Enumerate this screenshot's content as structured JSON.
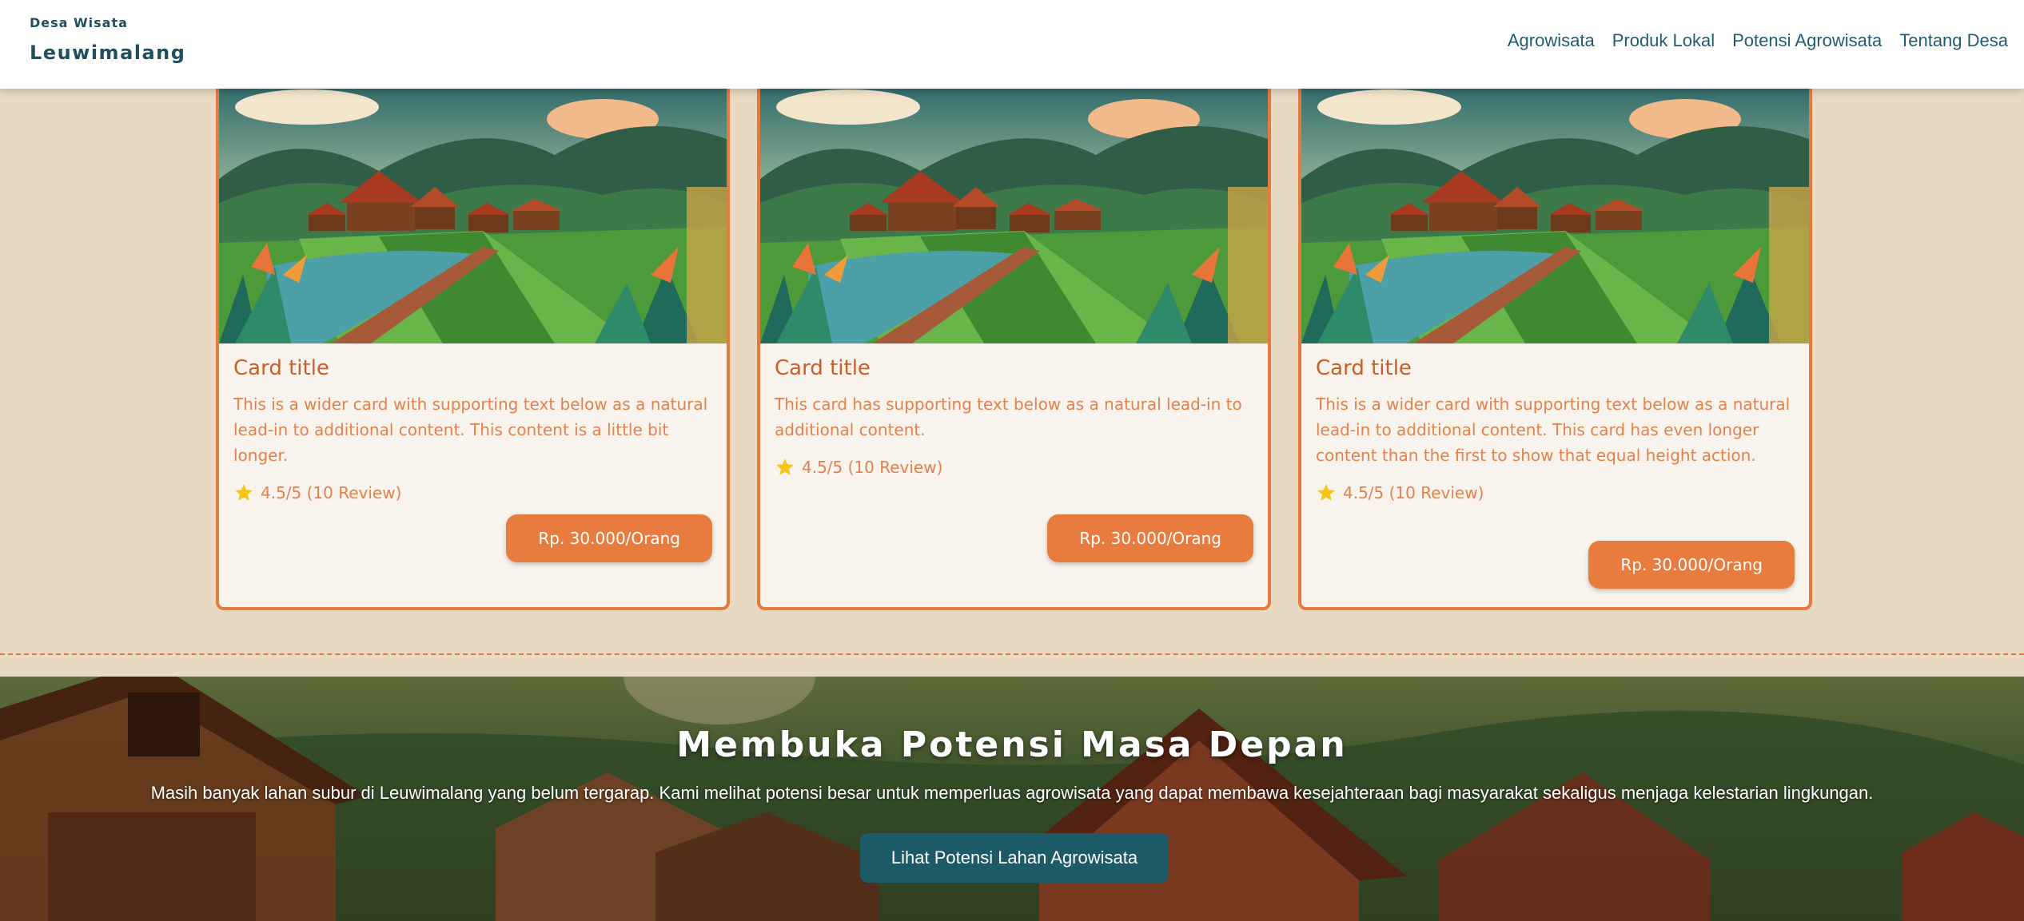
{
  "navbar": {
    "brand_top": "Desa Wisata",
    "brand_main": "Leuwimalang",
    "links": [
      "Agrowisata",
      "Produk Lokal",
      "Potensi Agrowisata",
      "Tentang Desa"
    ]
  },
  "cards": [
    {
      "title": "Card title",
      "text": "This is a wider card with supporting text below as a natural lead-in to additional content. This content is a little bit longer.",
      "rating": "4.5/5 (10 Review)",
      "price": "Rp. 30.000/Orang"
    },
    {
      "title": "Card title",
      "text": "This card has supporting text below as a natural lead-in to additional content.",
      "rating": "4.5/5 (10 Review)",
      "price": "Rp. 30.000/Orang"
    },
    {
      "title": "Card title",
      "text": "This is a wider card with supporting text below as a natural lead-in to additional content. This card has even longer content than the first to show that equal height action.",
      "rating": "4.5/5 (10 Review)",
      "price": "Rp. 30.000/Orang"
    }
  ],
  "hero": {
    "title": "Membuka Potensi Masa Depan",
    "subtitle": "Masih banyak lahan subur di Leuwimalang yang belum tergarap. Kami melihat potensi besar untuk memperluas agrowisata yang dapat membawa kesejahteraan bagi masyarakat sekaligus menjaga kelestarian lingkungan.",
    "button": "Lihat Potensi Lahan Agrowisata"
  },
  "icons": {
    "rating": "star-icon"
  },
  "colors": {
    "accent": "#e57a3e",
    "nav_text": "#1e5c6e",
    "page_bg": "#e8d9c2",
    "hero_button": "#1c5a68",
    "star": "#f5c518"
  }
}
